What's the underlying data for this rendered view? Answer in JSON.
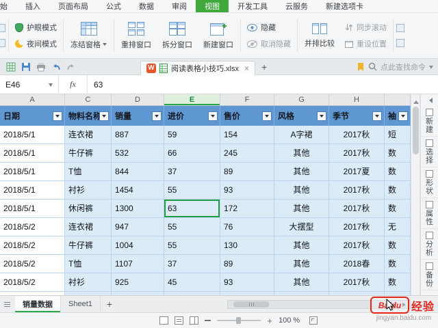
{
  "colors": {
    "accent_green": "#41a93c",
    "table_header_blue": "#5f97d2",
    "row_blue": "#dcebf8",
    "selection_green": "#1f9e43",
    "watermark_red": "#e3261d"
  },
  "menu_bar": {
    "tabs": [
      {
        "label": "开始",
        "active": false,
        "partial": true
      },
      {
        "label": "插入",
        "active": false
      },
      {
        "label": "页面布局",
        "active": false
      },
      {
        "label": "公式",
        "active": false
      },
      {
        "label": "数据",
        "active": false
      },
      {
        "label": "审阅",
        "active": false
      },
      {
        "label": "视图",
        "active": true
      },
      {
        "label": "开发工具",
        "active": false
      },
      {
        "label": "云服务",
        "active": false
      },
      {
        "label": "新建选项卡",
        "active": false
      }
    ]
  },
  "ribbon": {
    "eye_protect_label": "护眼模式",
    "night_mode_label": "夜间模式",
    "freeze_label": "冻结窗格",
    "rearrange_label": "重排窗口",
    "split_label": "拆分窗口",
    "new_window_label": "新建窗口",
    "hide_label": "隐藏",
    "unhide_label": "取消隐藏",
    "side_by_side_label": "并排比较",
    "sync_scroll_label": "同步滚动",
    "reset_position_label": "重设位置"
  },
  "tab_strip": {
    "document_tab": {
      "title": "阅读表格小技巧.xlsx",
      "close": "×"
    },
    "new_tab_label": "+",
    "find_command_hint": "点此查找命令"
  },
  "formula_bar": {
    "cell_reference": "E46",
    "fx_label": "fx",
    "value": "63"
  },
  "sheet": {
    "column_letters": [
      "A",
      "C",
      "D",
      "E",
      "F",
      "G",
      "H",
      ""
    ],
    "selected_column_letter": "E",
    "header_row": [
      "日期",
      "物料名称",
      "销量",
      "进价",
      "售价",
      "风格",
      "季节",
      "袖"
    ],
    "rows": [
      [
        "2018/5/1",
        "连衣裙",
        "887",
        "59",
        "154",
        "A字裙",
        "2017秋",
        "短"
      ],
      [
        "2018/5/1",
        "牛仔裤",
        "532",
        "66",
        "245",
        "其他",
        "2017秋",
        "数"
      ],
      [
        "2018/5/1",
        "T恤",
        "844",
        "37",
        "89",
        "其他",
        "2017夏",
        "数"
      ],
      [
        "2018/5/1",
        "衬衫",
        "1454",
        "55",
        "93",
        "其他",
        "2017秋",
        "数"
      ],
      [
        "2018/5/1",
        "休闲裤",
        "1300",
        "63",
        "172",
        "其他",
        "2017秋",
        "数"
      ],
      [
        "2018/5/2",
        "连衣裙",
        "947",
        "55",
        "76",
        "大摆型",
        "2017秋",
        "无"
      ],
      [
        "2018/5/2",
        "牛仔裤",
        "1004",
        "55",
        "130",
        "其他",
        "2017秋",
        "数"
      ],
      [
        "2018/5/2",
        "T恤",
        "1107",
        "37",
        "89",
        "其他",
        "2018春",
        "数"
      ],
      [
        "2018/5/2",
        "衬衫",
        "925",
        "45",
        "93",
        "其他",
        "2017秋",
        "数"
      ]
    ],
    "selection": {
      "cell_reference": "E46",
      "row_index": 4,
      "col_index": 3
    }
  },
  "sheet_tab_bar": {
    "tabs": [
      {
        "label": "销量数据",
        "active": true
      },
      {
        "label": "Sheet1",
        "active": false
      }
    ],
    "add_sheet_label": "+"
  },
  "status_bar": {
    "zoom_text": "100 %",
    "zoom_plus": "+"
  },
  "side_panel": {
    "items": [
      {
        "label": "新建"
      },
      {
        "label": "选择"
      },
      {
        "label": "形状"
      },
      {
        "label": "属性"
      },
      {
        "label": "分析"
      },
      {
        "label": "备份"
      }
    ]
  },
  "watermark": {
    "brand": "Baidu",
    "brand_cn": "经验",
    "url": "jingyan.baidu.com"
  }
}
